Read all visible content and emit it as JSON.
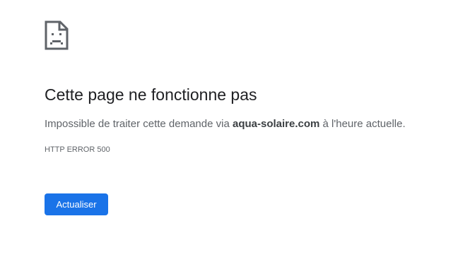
{
  "icon": "sad-page-icon",
  "title": "Cette page ne fonctionne pas",
  "description": {
    "prefix": "Impossible de traiter cette demande via ",
    "domain": "aqua-solaire.com",
    "suffix": " à l'heure actuelle."
  },
  "error_code": "HTTP ERROR 500",
  "reload_label": "Actualiser",
  "colors": {
    "button": "#1a73e8",
    "title": "#202124",
    "text": "#5f6368"
  }
}
